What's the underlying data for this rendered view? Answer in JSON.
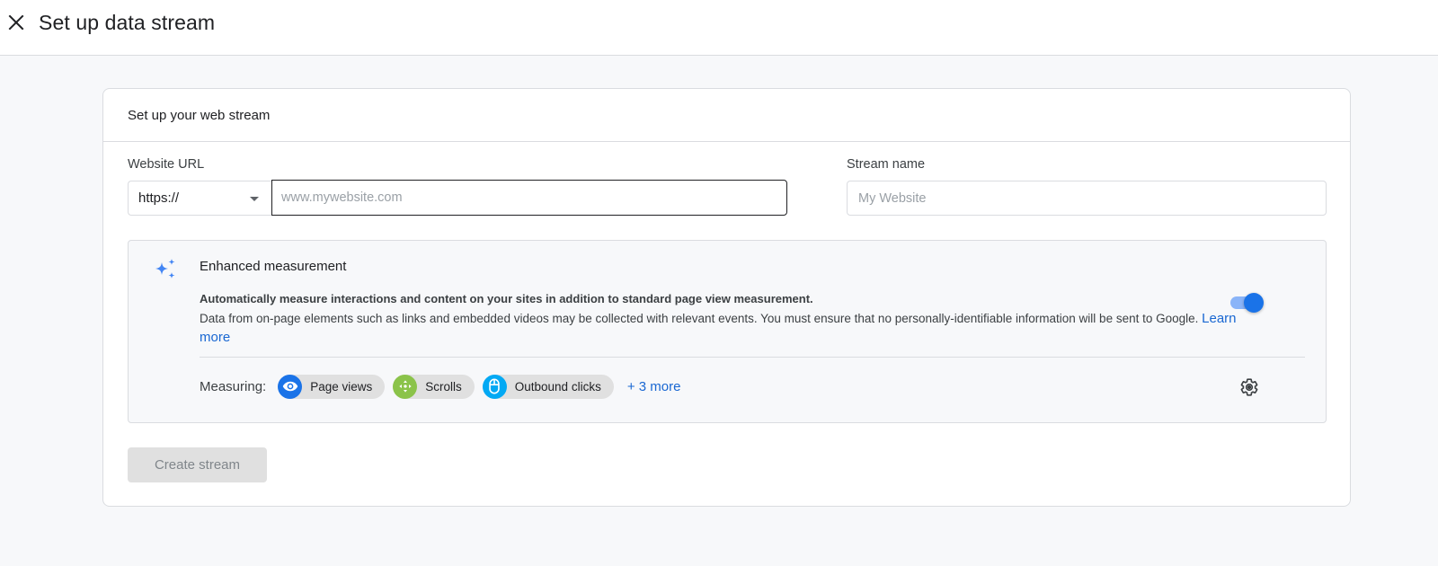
{
  "header": {
    "title": "Set up data stream",
    "close_icon": "close-icon"
  },
  "card": {
    "title": "Set up your web stream",
    "website_url": {
      "label": "Website URL",
      "protocol_selected": "https://",
      "url_value": "",
      "url_placeholder": "www.mywebsite.com"
    },
    "stream_name": {
      "label": "Stream name",
      "value": "",
      "placeholder": "My Website"
    },
    "enhanced_measurement": {
      "icon": "sparkle-icon",
      "title": "Enhanced measurement",
      "description_bold": "Automatically measure interactions and content on your sites in addition to standard page view measurement.",
      "description": "Data from on-page elements such as links and embedded videos may be collected with relevant events. You must ensure that no personally-identifiable information will be sent to Google.",
      "learn_more_label": "Learn more",
      "toggle_on": true,
      "measuring_label": "Measuring:",
      "chips": [
        {
          "label": "Page views",
          "icon": "eye-icon",
          "color": "#1a73e8"
        },
        {
          "label": "Scrolls",
          "icon": "scroll-arrows-icon",
          "color": "#8bc34a"
        },
        {
          "label": "Outbound clicks",
          "icon": "mouse-icon",
          "color": "#03a9f4"
        }
      ],
      "more_label": "+ 3 more",
      "settings_icon": "gear-icon"
    },
    "create_button_label": "Create stream",
    "create_button_disabled": true
  },
  "colors": {
    "accent": "#1a73e8",
    "link": "#1967d2",
    "page_bg": "#f7f8fa",
    "border": "#dadce0"
  }
}
